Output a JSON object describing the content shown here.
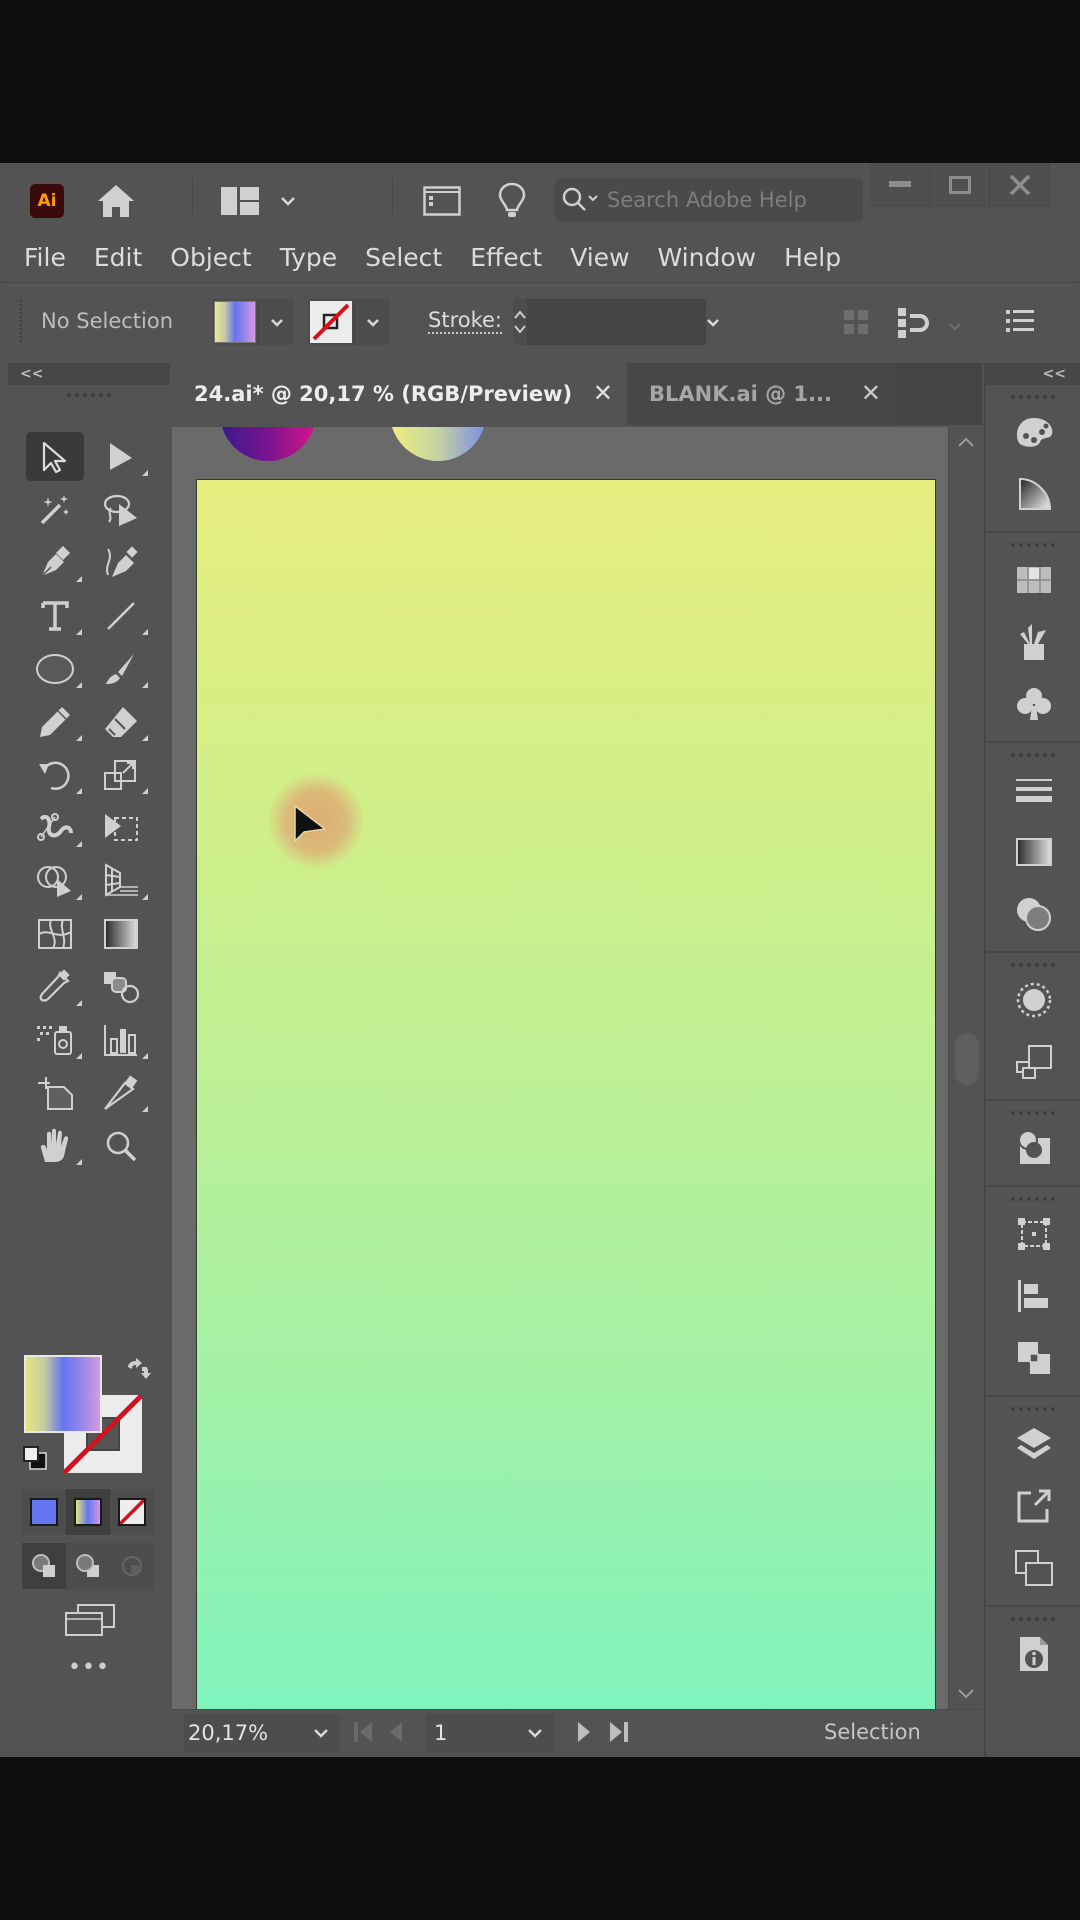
{
  "app": {
    "logo_text": "Ai",
    "title_bar": {
      "icons": [
        "home-icon",
        "workspace-layout-icon",
        "chevron-down-icon",
        "arrange-documents-icon",
        "lightbulb-icon"
      ],
      "search_placeholder": "Search Adobe Help",
      "window_controls": [
        "minimize",
        "maximize",
        "close"
      ]
    }
  },
  "menu": [
    "File",
    "Edit",
    "Object",
    "Type",
    "Select",
    "Effect",
    "View",
    "Window",
    "Help"
  ],
  "control_bar": {
    "selection_label": "No Selection",
    "fill": "gradient",
    "stroke": "none",
    "stroke_label": "Stroke:",
    "stroke_value": ""
  },
  "toolbar": {
    "collapse_label": "<<",
    "tools": [
      {
        "name": "selection-tool",
        "active": true
      },
      {
        "name": "direct-selection-tool"
      },
      {
        "name": "magic-wand-tool"
      },
      {
        "name": "lasso-tool"
      },
      {
        "name": "pen-tool"
      },
      {
        "name": "curvature-tool"
      },
      {
        "name": "type-tool"
      },
      {
        "name": "line-segment-tool"
      },
      {
        "name": "ellipse-tool"
      },
      {
        "name": "paintbrush-tool"
      },
      {
        "name": "pencil-tool"
      },
      {
        "name": "eraser-tool"
      },
      {
        "name": "rotate-tool"
      },
      {
        "name": "scale-tool"
      },
      {
        "name": "puppet-warp-tool"
      },
      {
        "name": "free-transform-tool"
      },
      {
        "name": "shape-builder-tool"
      },
      {
        "name": "perspective-grid-tool"
      },
      {
        "name": "mesh-tool"
      },
      {
        "name": "gradient-tool"
      },
      {
        "name": "eyedropper-tool"
      },
      {
        "name": "blend-tool"
      },
      {
        "name": "symbol-sprayer-tool"
      },
      {
        "name": "column-graph-tool"
      },
      {
        "name": "artboard-tool"
      },
      {
        "name": "slice-tool"
      },
      {
        "name": "hand-tool"
      },
      {
        "name": "zoom-tool"
      }
    ],
    "more_label": "•••"
  },
  "document": {
    "tabs": [
      {
        "label": "24.ai* @ 20,17 % (RGB/Preview)",
        "active": true
      },
      {
        "label": "BLANK.ai @ 1...",
        "active": false
      }
    ],
    "zoom_value": "20,17%",
    "page_value": "1",
    "status_text": "Selection"
  },
  "colors": {
    "artboard_gradient": [
      "#e6ed7e",
      "#bcf096",
      "#80f4bf"
    ],
    "fill_gradient": [
      "#e2e682",
      "#6574f1",
      "#d29be2"
    ],
    "none_slash": "#d6101e",
    "ai_logo_bg": "#3a0a0a",
    "ai_logo_fg": "#ff9a00"
  },
  "right_dock": {
    "collapse_label": "<<",
    "groups": [
      [
        "color-icon",
        "color-guide-icon"
      ],
      [
        "swatches-icon",
        "brushes-icon",
        "symbols-icon"
      ],
      [
        "stroke-icon",
        "gradient-icon",
        "transparency-icon"
      ],
      [
        "appearance-icon",
        "graphic-styles-icon"
      ],
      [
        "image-trace-icon"
      ],
      [
        "transform-icon",
        "align-icon",
        "pathfinder-icon"
      ],
      [
        "layers-icon",
        "asset-export-icon",
        "artboards-icon"
      ],
      [
        "document-info-icon"
      ]
    ]
  }
}
